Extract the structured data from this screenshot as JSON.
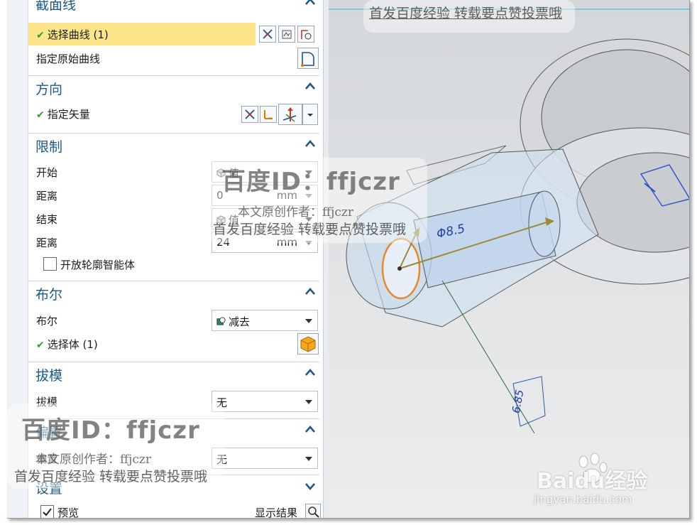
{
  "section_curve": {
    "title": "截面线",
    "select_curve": "选择曲线 (1)",
    "specify_original": "指定原始曲线"
  },
  "section_direction": {
    "title": "方向",
    "specify_vector": "指定矢量"
  },
  "section_limits": {
    "title": "限制",
    "start_label": "开始",
    "start_value": "值",
    "start_distance_label": "距离",
    "start_distance": "0",
    "end_label": "结束",
    "end_value": "值",
    "end_distance_label": "距离",
    "end_distance": "24",
    "unit": "mm",
    "open_profile": "开放轮廓智能体"
  },
  "section_boolean": {
    "title": "布尔",
    "boolean_label": "布尔",
    "boolean_value": "减去",
    "select_body": "选择体 (1)"
  },
  "section_draft": {
    "title": "拔模",
    "draft_label": "拔模",
    "draft_value": "无"
  },
  "section_offset": {
    "title": "偏置",
    "offset_label": "偏置",
    "offset_value": "无"
  },
  "section_settings": {
    "title": "设置"
  },
  "preview": {
    "label": "预览",
    "show_result": "显示结果"
  },
  "viewport": {
    "dim_diameter": "Φ8.5",
    "dim_length": "6.85"
  },
  "watermarks": {
    "baidu_id": "百度ID：ffjczr",
    "author": "本文原创作者：ffjczr",
    "first_post": "首发百度经验  转载要点赞投票哦",
    "baidu_logo": "Baidu经验",
    "baidu_url": "jingyan.baidu.com"
  },
  "colors": {
    "accent_title": "#1b5a8a",
    "highlight_row": "#fde58a",
    "check_green": "#2f9e2f",
    "viewport_bg": "#dcdfe2"
  }
}
